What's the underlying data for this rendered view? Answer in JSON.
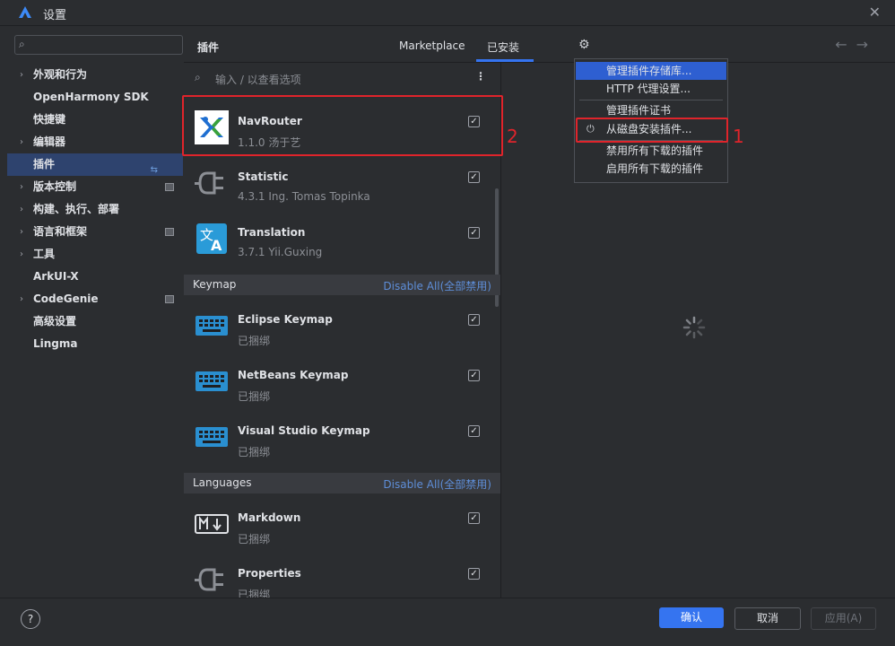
{
  "window": {
    "title": "设置"
  },
  "sidebar": {
    "search_placeholder": "",
    "items": [
      {
        "label": "外观和行为",
        "arrow": "›"
      },
      {
        "label": "OpenHarmony SDK",
        "arrow": ""
      },
      {
        "label": "快捷键",
        "arrow": ""
      },
      {
        "label": "编辑器",
        "arrow": "›"
      },
      {
        "label": "插件",
        "arrow": "",
        "selected": true
      },
      {
        "label": "版本控制",
        "arrow": "›"
      },
      {
        "label": "构建、执行、部署",
        "arrow": "›"
      },
      {
        "label": "语言和框架",
        "arrow": "›"
      },
      {
        "label": "工具",
        "arrow": "›"
      },
      {
        "label": "ArkUI-X",
        "arrow": ""
      },
      {
        "label": "CodeGenie",
        "arrow": "›"
      },
      {
        "label": "高级设置",
        "arrow": ""
      },
      {
        "label": "Lingma",
        "arrow": ""
      }
    ]
  },
  "header": {
    "title": "插件",
    "tabs": [
      {
        "label": "Marketplace"
      },
      {
        "label": "已安装"
      }
    ],
    "active_tab": "已安装"
  },
  "list": {
    "filter_placeholder": "输入 / 以查看选项",
    "plugins": [
      {
        "name": "NavRouter",
        "meta": "1.1.0  汤于艺",
        "checked": true
      },
      {
        "name": "Statistic",
        "meta": "4.3.1  Ing. Tomas Topinka",
        "checked": true
      },
      {
        "name": "Translation",
        "meta": "3.7.1  Yii.Guxing",
        "checked": true
      }
    ],
    "sections": [
      {
        "title": "Keymap",
        "link": "Disable All(全部禁用)",
        "plugins": [
          {
            "name": "Eclipse Keymap",
            "meta": "已捆绑",
            "checked": true
          },
          {
            "name": "NetBeans Keymap",
            "meta": "已捆绑",
            "checked": true
          },
          {
            "name": "Visual Studio Keymap",
            "meta": "已捆绑",
            "checked": true
          }
        ]
      },
      {
        "title": "Languages",
        "link": "Disable All(全部禁用)",
        "plugins": [
          {
            "name": "Markdown",
            "meta": "已捆绑",
            "checked": true
          },
          {
            "name": "Properties",
            "meta": "已捆绑",
            "checked": true
          }
        ]
      }
    ]
  },
  "menu": {
    "items": [
      {
        "label": "管理插件存储库..."
      },
      {
        "label": "HTTP 代理设置..."
      },
      {
        "label": "管理插件证书"
      },
      {
        "label": "从磁盘安装插件..."
      },
      {
        "label": "禁用所有下载的插件"
      },
      {
        "label": "启用所有下载的插件"
      }
    ]
  },
  "footer": {
    "help": "?",
    "ok": "确认",
    "cancel": "取消",
    "apply": "应用(A)"
  },
  "annotations": {
    "one": "1",
    "two": "2"
  },
  "colors": {
    "accent": "#3574f0",
    "annotation": "#e0242b",
    "link": "#5e8ed8"
  }
}
